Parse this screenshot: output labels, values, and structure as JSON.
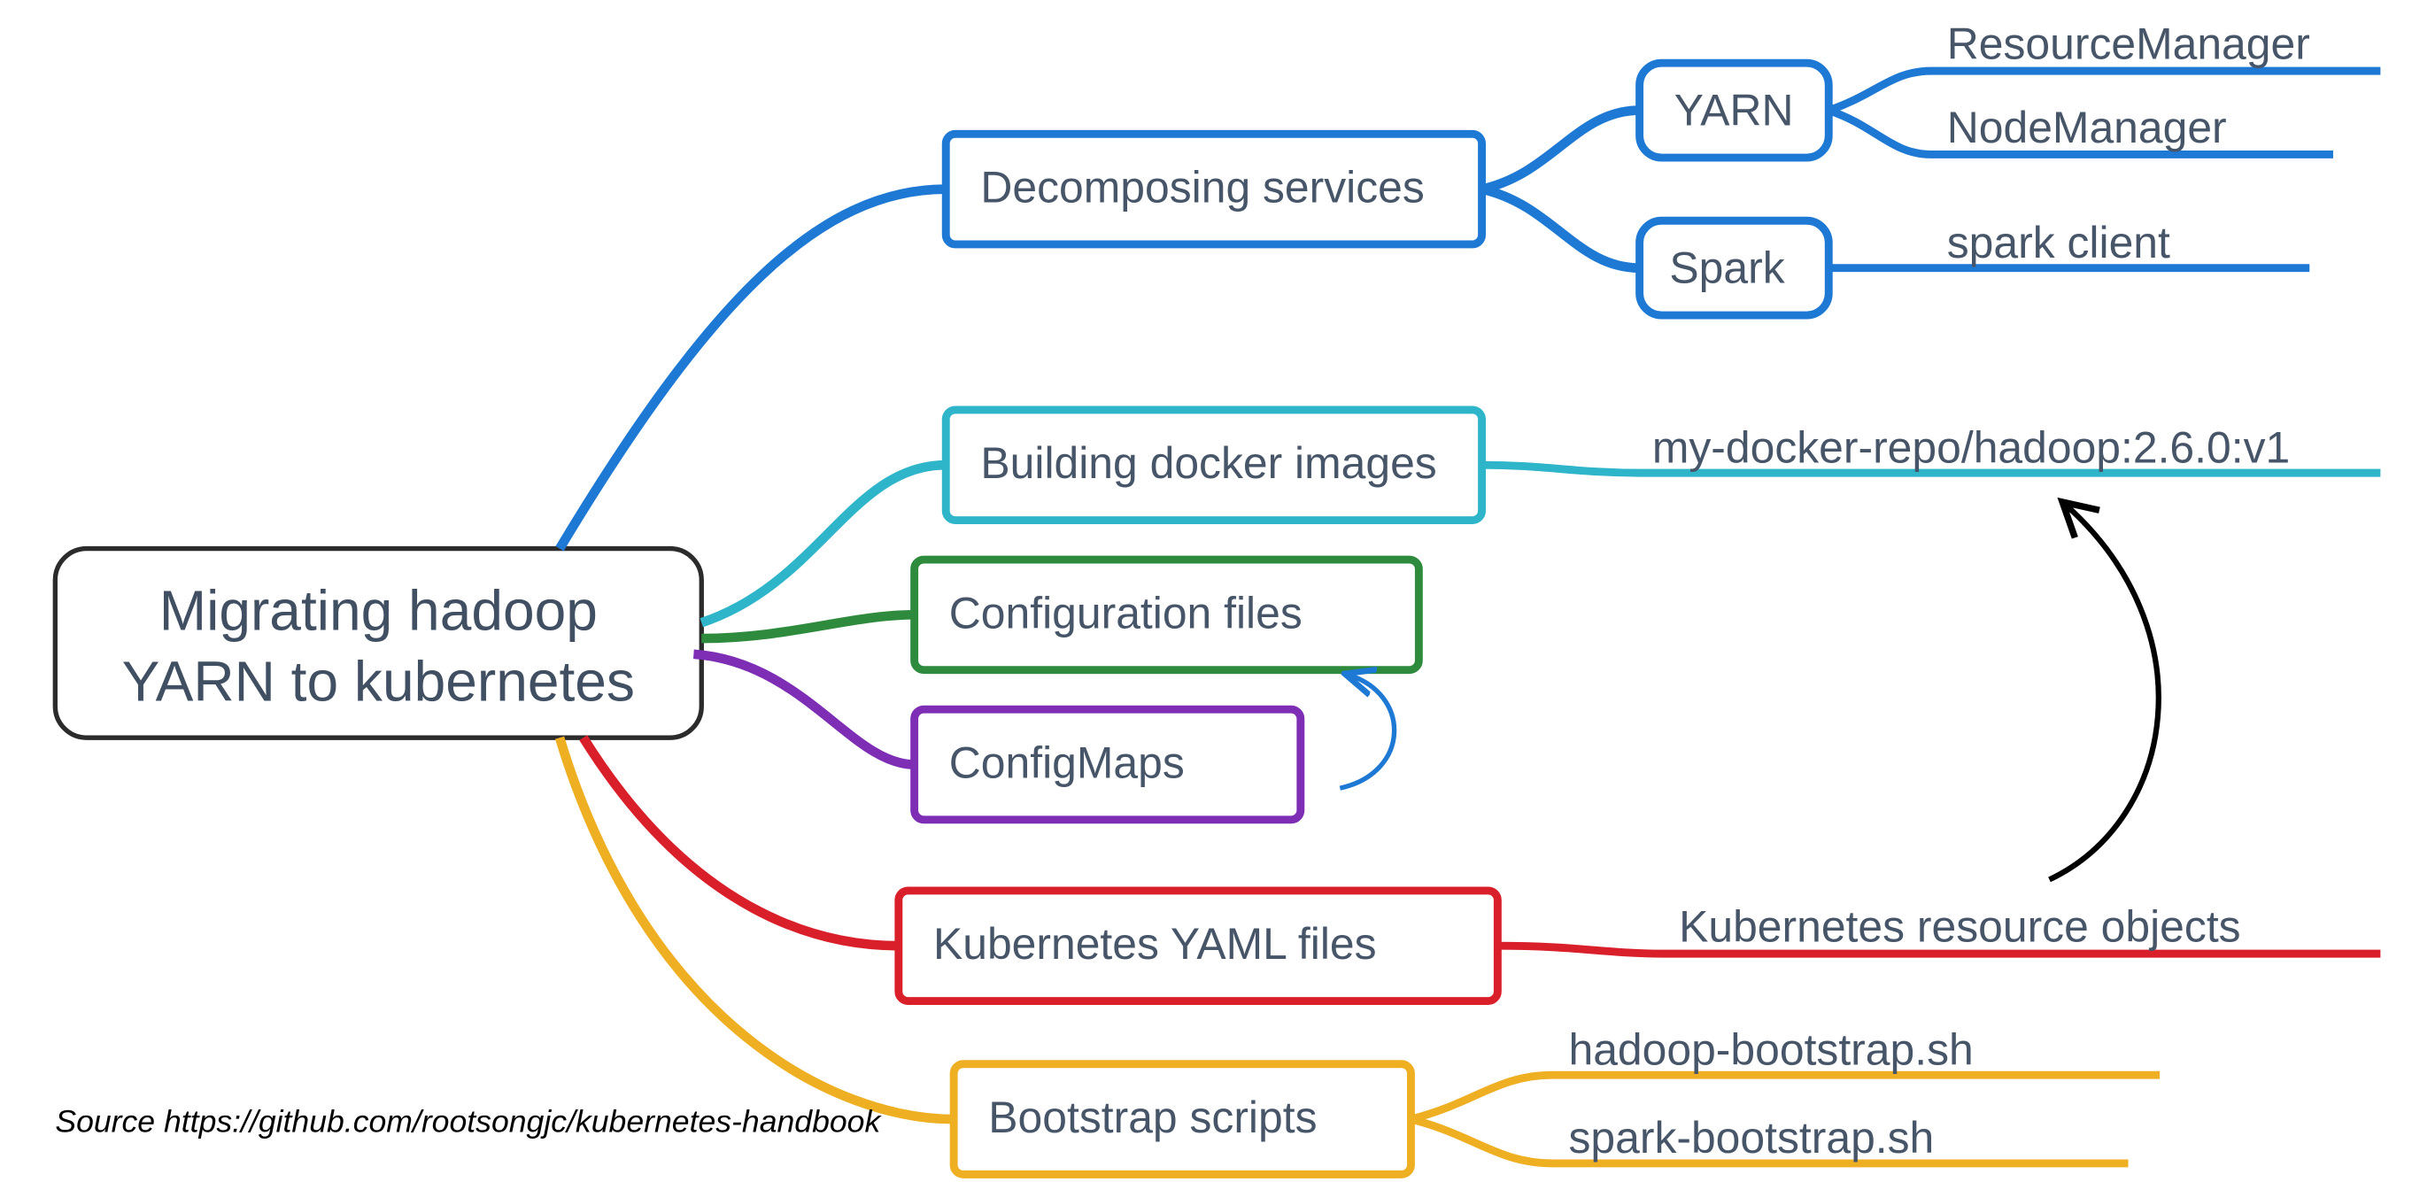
{
  "root": {
    "line1": "Migrating hadoop",
    "line2": "YARN to kubernetes"
  },
  "branches": {
    "decomposing": {
      "label": "Decomposing services",
      "color": "#1E79D5",
      "children": {
        "yarn": {
          "label": "YARN",
          "children": [
            "ResourceManager",
            "NodeManager"
          ]
        },
        "spark": {
          "label": "Spark",
          "children": [
            "spark client"
          ]
        }
      }
    },
    "docker": {
      "label": "Building docker images",
      "color": "#2EB5C9",
      "child": "my-docker-repo/hadoop:2.6.0:v1"
    },
    "config_files": {
      "label": "Configuration files",
      "color": "#2E8B3D"
    },
    "configmaps": {
      "label": "ConfigMaps",
      "color": "#7E2DB5"
    },
    "k8s_yaml": {
      "label": "Kubernetes YAML files",
      "color": "#D9202A",
      "child": "Kubernetes resource objects"
    },
    "bootstrap": {
      "label": "Bootstrap scripts",
      "color": "#EFAF23",
      "children": [
        "hadoop-bootstrap.sh",
        "spark-bootstrap.sh"
      ]
    }
  },
  "source": "Source https://github.com/rootsongjc/kubernetes-handbook",
  "relation_arrows": {
    "configmaps_to_config_files": true,
    "k8s_resources_to_docker_image": true
  }
}
